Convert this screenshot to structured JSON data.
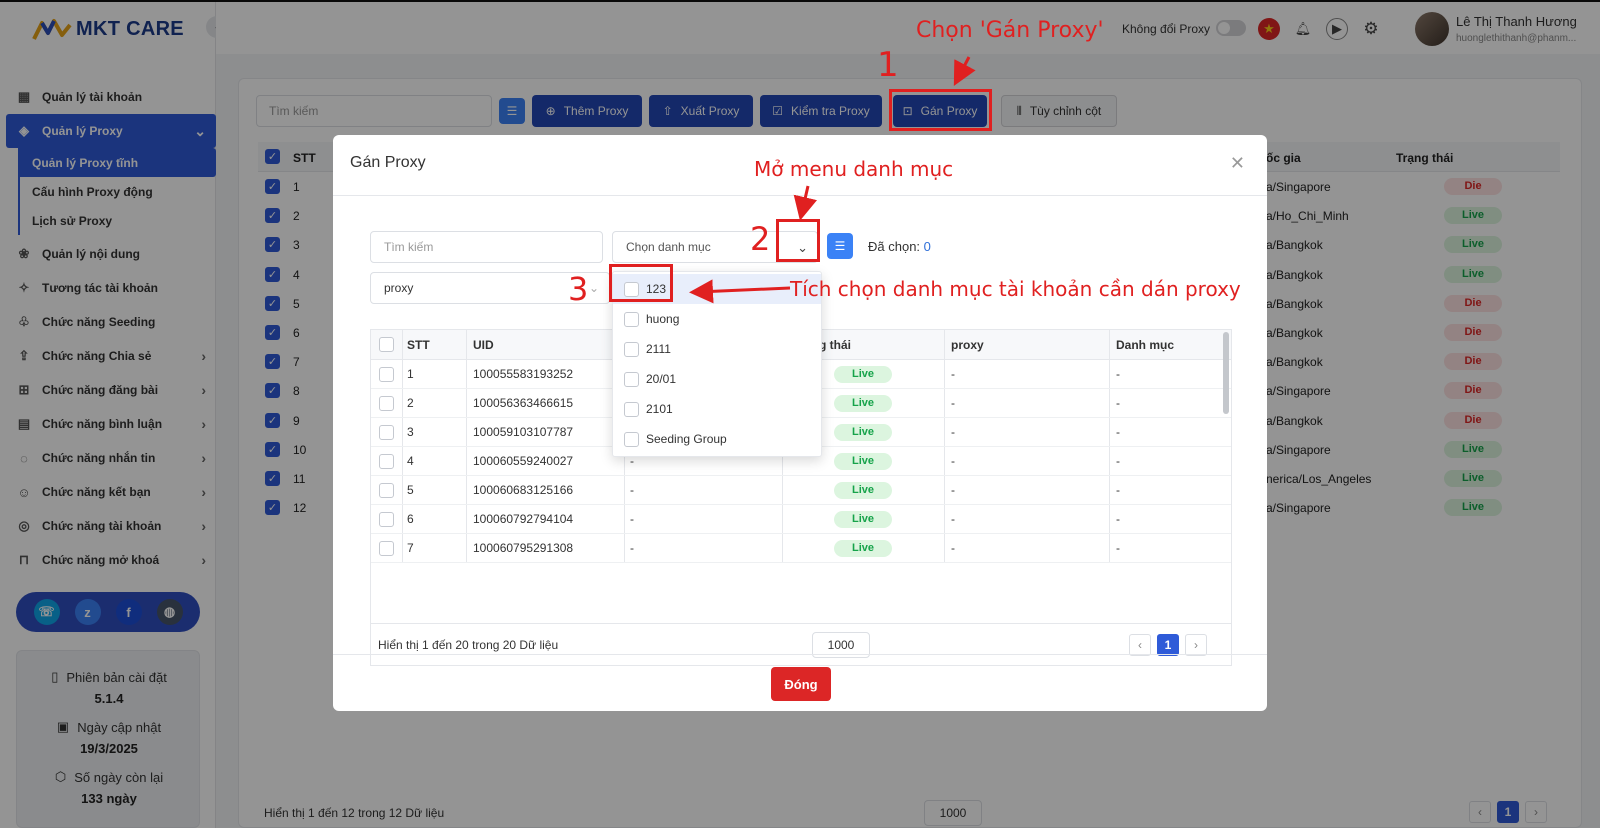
{
  "app": {
    "logo": "MKT CARE"
  },
  "sidebar": {
    "items": [
      {
        "label": "Quản lý tài khoản",
        "icon": "grid-icon"
      },
      {
        "label": "Quản lý Proxy",
        "icon": "layers-icon"
      },
      {
        "label": "Quản lý nội dung",
        "icon": "content-icon"
      },
      {
        "label": "Tương tác tài khoản",
        "icon": "sparkle-icon"
      },
      {
        "label": "Chức năng Seeding",
        "icon": "seed-icon"
      },
      {
        "label": "Chức năng Chia sẻ",
        "icon": "share-icon"
      },
      {
        "label": "Chức năng đăng bài",
        "icon": "post-icon"
      },
      {
        "label": "Chức năng bình luận",
        "icon": "comment-icon"
      },
      {
        "label": "Chức năng nhắn tin",
        "icon": "message-icon"
      },
      {
        "label": "Chức năng kết bạn",
        "icon": "add-friend-icon"
      },
      {
        "label": "Chức năng tài khoản",
        "icon": "account-icon"
      },
      {
        "label": "Chức năng mở khoá",
        "icon": "lock-icon"
      }
    ],
    "sub_items": [
      "Quản lý Proxy tĩnh",
      "Cấu hình Proxy động",
      "Lịch sử Proxy"
    ],
    "info": {
      "version_label": "Phiên bản cài đặt",
      "version": "5.1.4",
      "updated_label": "Ngày cập nhật",
      "updated": "19/3/2025",
      "days_label": "Số ngày còn lại",
      "days": "133 ngày"
    }
  },
  "header": {
    "toggle_label": "Không đổi Proxy",
    "user_name": "Lê Thị Thanh Hương",
    "user_email": "huonglethithanh@phanm..."
  },
  "toolbar": {
    "search_placeholder": "Tìm kiếm",
    "add": "Thêm Proxy",
    "export": "Xuất Proxy",
    "check": "Kiểm tra Proxy",
    "assign": "Gán Proxy",
    "columns": "Tùy chỉnh cột"
  },
  "bg_table": {
    "headers": {
      "stt": "STT",
      "country": "ốc gia",
      "status": "Trạng thái"
    },
    "rows": [
      {
        "stt": "1",
        "country": "a/Singapore",
        "status": "Die"
      },
      {
        "stt": "2",
        "country": "a/Ho_Chi_Minh",
        "status": "Live"
      },
      {
        "stt": "3",
        "country": "a/Bangkok",
        "status": "Live"
      },
      {
        "stt": "4",
        "country": "a/Bangkok",
        "status": "Live"
      },
      {
        "stt": "5",
        "country": "a/Bangkok",
        "status": "Die"
      },
      {
        "stt": "6",
        "country": "a/Bangkok",
        "status": "Die"
      },
      {
        "stt": "7",
        "country": "a/Bangkok",
        "status": "Die"
      },
      {
        "stt": "8",
        "country": "a/Singapore",
        "status": "Die"
      },
      {
        "stt": "9",
        "country": "a/Bangkok",
        "status": "Die"
      },
      {
        "stt": "10",
        "country": "a/Singapore",
        "status": "Live"
      },
      {
        "stt": "11",
        "country": "nerica/Los_Angeles",
        "status": "Live"
      },
      {
        "stt": "12",
        "country": "a/Singapore",
        "status": "Live"
      }
    ],
    "footer": "Hiển thị 1 đến 12 trong 12 Dữ liệu",
    "page_size": "1000",
    "page": "1"
  },
  "modal": {
    "title": "Gán Proxy",
    "search_placeholder": "Tìm kiếm",
    "category_placeholder": "Chọn danh mục",
    "selected_label": "Đã chọn:",
    "selected_count": "0",
    "proxy_value": "proxy",
    "table": {
      "headers": {
        "stt": "STT",
        "uid": "UID",
        "status": "g thái",
        "proxy": "proxy",
        "category": "Danh mục"
      },
      "rows": [
        {
          "stt": "1",
          "uid": "100055583193252",
          "name": "-",
          "status": "Live",
          "proxy": "-",
          "category": "-"
        },
        {
          "stt": "2",
          "uid": "100056363466615",
          "name": "-",
          "status": "Live",
          "proxy": "-",
          "category": "-"
        },
        {
          "stt": "3",
          "uid": "100059103107787",
          "name": "-",
          "status": "Live",
          "proxy": "-",
          "category": "-"
        },
        {
          "stt": "4",
          "uid": "100060559240027",
          "name": "-",
          "status": "Live",
          "proxy": "-",
          "category": "-"
        },
        {
          "stt": "5",
          "uid": "100060683125166",
          "name": "-",
          "status": "Live",
          "proxy": "-",
          "category": "-"
        },
        {
          "stt": "6",
          "uid": "100060792794104",
          "name": "-",
          "status": "Live",
          "proxy": "-",
          "category": "-"
        },
        {
          "stt": "7",
          "uid": "100060795291308",
          "name": "-",
          "status": "Live",
          "proxy": "-",
          "category": "-"
        }
      ]
    },
    "footer": "Hiển thị 1 đến 20 trong 20 Dữ liệu",
    "page_size": "1000",
    "page": "1",
    "close": "Đóng",
    "dropdown_options": [
      "123",
      "huong",
      "2111",
      "20/01",
      "2101",
      "Seeding Group"
    ]
  },
  "annotations": {
    "step1": "1",
    "step2": "2",
    "step3": "3",
    "text1": "Chọn 'Gán Proxy'",
    "text2": "Mở menu danh mục",
    "text3": "Tích chọn danh mục tài khoản cần dán proxy"
  },
  "colors": {
    "primary": "#2f5bd8",
    "live": "#16a34a",
    "die": "#dc2626",
    "annotation": "#e02020"
  }
}
